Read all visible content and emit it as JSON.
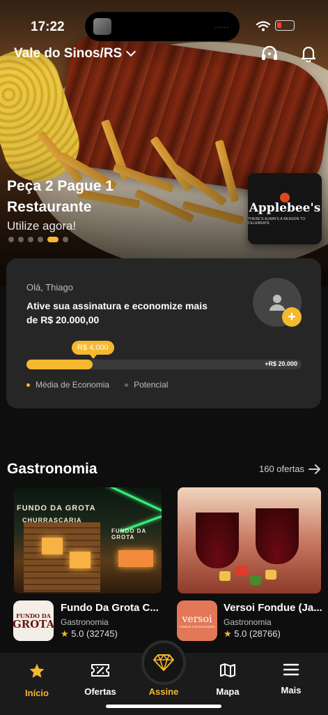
{
  "status_bar": {
    "time": "17:22",
    "island_dots": "·····"
  },
  "header": {
    "location": "Vale do Sinos/RS"
  },
  "hero": {
    "title": "Peça 2 Pague 1 Restaurante",
    "subtitle": "Utilize agora!",
    "slides": 6,
    "active_slide": 4,
    "brand": {
      "name": "Applebee's",
      "tagline": "THERE'S ALWAYS A REASON TO CELEBRATE"
    }
  },
  "savings_card": {
    "greeting": "Olá, Thiago",
    "cta": "Ative sua assinatura e economize mais de  R$ 20.000,00",
    "bubble": "R$ 4.000",
    "bar_end_label": "+R$ 20.000",
    "progress": 0.24,
    "legend": {
      "average": "Média de Economia",
      "potential": "Potencial"
    }
  },
  "section": {
    "title": "Gastronomia",
    "link": "160 ofertas"
  },
  "offers": [
    {
      "name": "Fundo Da Grota C...",
      "category": "Gastronomia",
      "rating": "5.0",
      "reviews": "(32745)",
      "logo_top": "FUNDO DA",
      "logo_main": "GROTA",
      "sign": "FUNDO DA GROTA",
      "sign2": "CHURRASCARIA",
      "sign3": "FUNDO DA GROTA"
    },
    {
      "name": "Versoi Fondue (Ja...",
      "category": "Gastronomia",
      "rating": "5.0",
      "reviews": "(28766)",
      "logo": "versoi",
      "logo_sub": "FONDUE & RESTAURANTE"
    }
  ],
  "tabs": [
    {
      "label": "Início",
      "icon": "star-icon",
      "active": true
    },
    {
      "label": "Ofertas",
      "icon": "ticket-icon",
      "active": false
    },
    {
      "label": "Assine",
      "icon": "diamond-icon",
      "active": false
    },
    {
      "label": "Mapa",
      "icon": "map-icon",
      "active": false
    },
    {
      "label": "Mais",
      "icon": "menu-icon",
      "active": false
    }
  ],
  "colors": {
    "accent": "#f5b82e",
    "background": "#0e0e0e",
    "card": "#262626",
    "battery_low": "#ff3b30"
  }
}
